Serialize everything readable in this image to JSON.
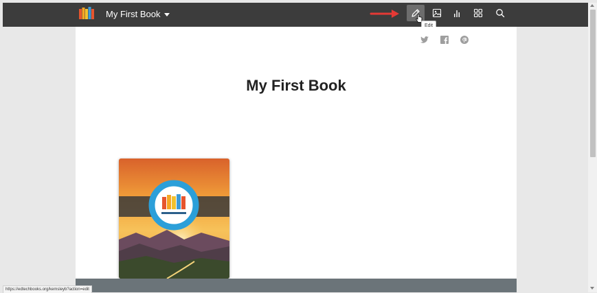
{
  "topbar": {
    "book_title": "My First Book",
    "tools": [
      {
        "icon": "pencil-icon",
        "tooltip": "Edit"
      },
      {
        "icon": "image-icon"
      },
      {
        "icon": "bar-chart-icon"
      },
      {
        "icon": "grid-icon"
      },
      {
        "icon": "search-icon"
      }
    ],
    "tooltip_text": "Edit"
  },
  "share": [
    "twitter-icon",
    "facebook-icon",
    "pinterest-icon"
  ],
  "page": {
    "title": "My First Book"
  },
  "status_bar": {
    "url": "https://edtechbooks.org/kemsleyb?action=edit"
  },
  "colors": {
    "topbar": "#3c3c3c",
    "arrow": "#e53935",
    "page": "#ffffff",
    "background": "#e8e8e8",
    "footer": "#6b7479"
  }
}
